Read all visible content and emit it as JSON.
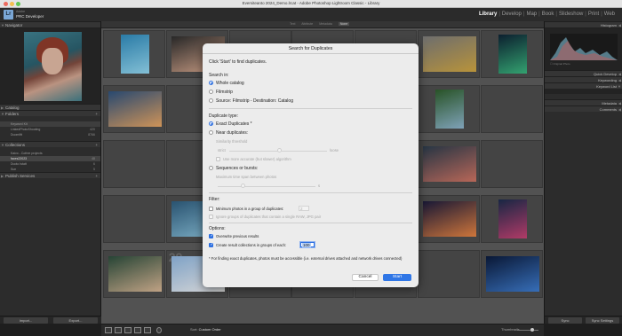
{
  "window": {
    "title": "Eversiteanto 2024_Demo.lrcat - Adobe Photoshop Lightroom Classic - Library"
  },
  "header": {
    "brand_line1": "Adobe",
    "brand_line2": "Lightroom Classic",
    "brand_line3": "PRC Developer",
    "logo": "Lr",
    "modules": [
      "Library",
      "Develop",
      "Map",
      "Book",
      "Slideshow",
      "Print",
      "Web"
    ],
    "active_module": "Library"
  },
  "left_panel": {
    "navigator": "Navigator",
    "catalog": "Catalog",
    "folders": "Folders",
    "collections": "Collections",
    "publish_services": "Publish Services",
    "folder_rows": [
      {
        "label": "Keyword Kit",
        "count": ""
      },
      {
        "label": "LinkedPhotoShooting",
        "count": "420"
      },
      {
        "label": "Duomiftt",
        "count": "8766"
      }
    ],
    "collection_rows": [
      {
        "label": "Kaivo - Cofree projects",
        "count": ""
      },
      {
        "label": "faces22023",
        "count": "48"
      },
      {
        "label": "Duoto Istatt",
        "count": "6"
      },
      {
        "label": "Sun",
        "count": "5"
      }
    ],
    "import_label": "Import...",
    "export_label": "Export..."
  },
  "right_panel": {
    "histogram": "Histogram",
    "original_photo": "Original Photo",
    "quick_develop": "Quick Develop",
    "keywording": "Keywording",
    "keyword_list": "Keyword List",
    "metadata": "Metadata",
    "comments": "Comments",
    "sync_label": "Sync",
    "sync_settings_label": "Sync Settings"
  },
  "center": {
    "filter_tabs": [
      "Text",
      "Attribute",
      "Metadata",
      "None"
    ],
    "active_filter": "None",
    "cell_numbers": [
      "",
      "",
      "",
      "",
      "",
      "",
      "",
      "",
      "",
      "",
      "14",
      "",
      "",
      "",
      "",
      "",
      "21",
      "",
      "",
      "",
      "",
      "",
      "",
      "",
      "",
      "",
      "",
      "",
      "",
      "29",
      "",
      "",
      "",
      "",
      "",
      "",
      "",
      "",
      "",
      ""
    ]
  },
  "toolbar": {
    "sort_label": "Sort:",
    "sort_value": "Custom Order",
    "thumbnails_label": "Thumbnails"
  },
  "dialog": {
    "title": "Search for Duplicates",
    "intro": "Click 'Start' to find duplicates.",
    "search_in_label": "Search in:",
    "search_in_options": [
      "Whole catalog",
      "Filmstrip",
      "Source: Filmstrip - Destination: Catalog"
    ],
    "search_in_selected": 0,
    "duplicate_type_label": "Duplicate type:",
    "exact_label": "Exact Duplicates *",
    "near_label": "Near duplicates:",
    "similarity_label": "Similarity threshold",
    "similarity_left": "strict",
    "similarity_right": "loose",
    "accurate_label": "Use more accurate (but slower) algorithm",
    "sequences_label": "Sequences or bursts:",
    "max_time_label": "Maximum time span between photos",
    "max_time_unit": "s",
    "filter_label": "Filter:",
    "min_photos_label": "Minimum photos in a group of duplicates:",
    "min_photos_value": "2",
    "ignore_label": "Ignore groups of duplicates that contain a single RAW, JPG pair",
    "options_label": "Options:",
    "overwrite_label": "Overwrite previous results",
    "create_label": "Create result collections in groups of each:",
    "create_value": "100",
    "note": "* For finding exact duplicates, photos must be accessible (i.e. external drives attached and network drives connected)",
    "cancel_label": "Cancel",
    "start_label": "Start"
  },
  "colors": {
    "accent": "#2f76e6",
    "panel": "#303030",
    "grid": "#5a5a5a"
  }
}
